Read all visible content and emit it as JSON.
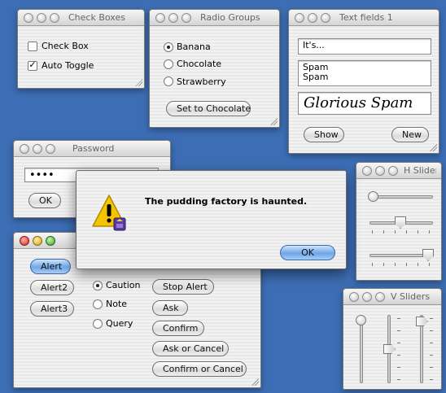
{
  "windows": {
    "check_boxes": {
      "title": "Check Boxes",
      "items": [
        {
          "label": "Check Box",
          "checked": false
        },
        {
          "label": "Auto Toggle",
          "checked": true
        }
      ]
    },
    "radio_groups": {
      "title": "Radio Groups",
      "options": [
        "Banana",
        "Chocolate",
        "Strawberry"
      ],
      "selected": "Banana",
      "button": "Set to Chocolate"
    },
    "text_fields": {
      "title": "Text fields 1",
      "field1": "It's...",
      "field2": "Spam\nSpam",
      "field3": "Glorious Spam",
      "show_button": "Show",
      "new_button": "New"
    },
    "password": {
      "title": "Password",
      "value": "••••",
      "ok_button": "OK"
    },
    "alerts": {
      "buttons_left": [
        "Alert",
        "Alert2",
        "Alert3"
      ],
      "radios": [
        "Caution",
        "Note",
        "Query"
      ],
      "selected_radio": "Caution",
      "buttons_right": [
        "Stop Alert",
        "Ask",
        "Confirm",
        "Ask or Cancel",
        "Confirm or Cancel"
      ]
    },
    "h_sliders": {
      "title": "H Sliders",
      "levels": [
        0.0,
        0.45,
        0.95
      ]
    },
    "v_sliders": {
      "title": "V Sliders",
      "levels": [
        0.0,
        0.5,
        0.05
      ]
    }
  },
  "dialog": {
    "message": "The pudding factory is haunted.",
    "ok_button": "OK",
    "icon": "caution-icon"
  },
  "colors": {
    "desktop": "#3d6eb5",
    "default_button": "#6ea6e6",
    "caution_yellow": "#f5c400"
  }
}
